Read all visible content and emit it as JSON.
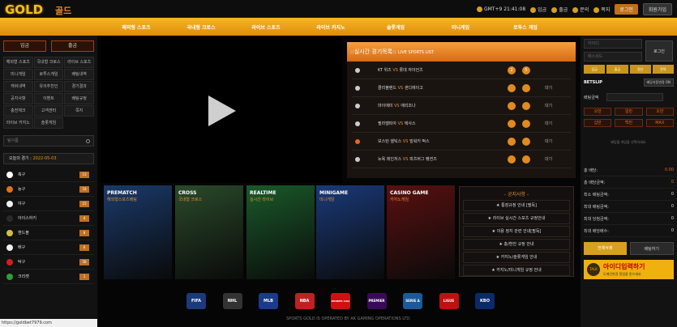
{
  "header": {
    "logo": "GOLD",
    "logo_ko": "골드",
    "clock": "GMT+9 21:41:08",
    "links": [
      "입금",
      "출금",
      "문의",
      "쪽지"
    ],
    "login": "로그인",
    "join": "회원가입"
  },
  "nav": [
    "해외형 스포츠",
    "국내형 크로스",
    "라이브 스포츠",
    "라이브 카지노",
    "슬롯게임",
    "미니게임",
    "로투스 게임"
  ],
  "left": {
    "deposit": "입금",
    "withdraw": "출금",
    "menu": [
      "해외형 스포츠",
      "국내형 크로스",
      "라이브 스포츠",
      "미니게임",
      "로투스게임",
      "배팅내역",
      "캐쉬내역",
      "유의추천인",
      "경기결과",
      "공지사항",
      "이벤트",
      "배팅규정",
      "충전체크",
      "고객센터",
      "쪽지",
      "라이브 카지노",
      "슬롯게임"
    ],
    "search_placeholder": "팀이름",
    "today": "오늘의 경기 :",
    "today_date": "2022-05-03",
    "sports": [
      {
        "name": "축구",
        "count": "13",
        "color": "#ffffff"
      },
      {
        "name": "농구",
        "count": "18",
        "color": "#e07020"
      },
      {
        "name": "야구",
        "count": "15",
        "color": "#f0f0f0"
      },
      {
        "name": "아이스하키",
        "count": "4",
        "color": "#2a2a2a"
      },
      {
        "name": "핸드볼",
        "count": "8",
        "color": "#d0c040"
      },
      {
        "name": "배구",
        "count": "6",
        "color": "#f0f0f0"
      },
      {
        "name": "탁구",
        "count": "58",
        "color": "#d02020"
      },
      {
        "name": "크리켓",
        "count": "1",
        "color": "#30a030"
      }
    ],
    "status_url": "https://goldbet7979.com"
  },
  "live": {
    "title": "::실시간 경기목록::",
    "title_en": "LIVE SPORTS LIST",
    "rows": [
      {
        "home": "KT 위즈",
        "vs": "VS",
        "away": "롯데 자이언츠",
        "status": ""
      },
      {
        "home": "클리블랜드",
        "vs": "VS",
        "away": "샌디에이고",
        "status": "대기"
      },
      {
        "home": "마이애미",
        "vs": "VS",
        "away": "애리조나",
        "status": "대기"
      },
      {
        "home": "필라델피아",
        "vs": "VS",
        "away": "텍사스",
        "status": "대기"
      },
      {
        "home": "보스턴 셀틱스",
        "vs": "VS",
        "away": "밀워키 벅스",
        "status": "대기"
      },
      {
        "home": "뉴욕 레인저스",
        "vs": "VS",
        "away": "피츠버그 펭귄즈",
        "status": "대기"
      }
    ],
    "score": [
      "2",
      "5"
    ]
  },
  "promos": [
    {
      "title": "PREMATCH",
      "sub": "해외형스포츠베팅",
      "bg": "#1a3a6a"
    },
    {
      "title": "CROSS",
      "sub": "국내형 크로스",
      "bg": "#2a4a2a"
    },
    {
      "title": "REALTIME",
      "sub": "실시간 라이브",
      "bg": "#1a5a2a"
    },
    {
      "title": "MINIGAME",
      "sub": "미니게임",
      "bg": "#1a3a7a"
    },
    {
      "title": "CASINO GAME",
      "sub": "카지노게임",
      "bg": "#5a1010"
    }
  ],
  "notice": {
    "title": "- 공지사항 -",
    "items": [
      "★ 통장규정 안내 [필독]",
      "★ 라이브 실시간 스포츠 규정안내",
      "★ 이용 정지 관련 안내[필독]",
      "★ 충/환전 규정 안내",
      "★ 카지노/슬롯게임 안내",
      "★ 카지노/미니게임 규정 안내"
    ]
  },
  "logos": [
    "FIFA",
    "NHL",
    "MLB",
    "NBA",
    "BUNDES LIGA",
    "PREMIER",
    "SERIE A",
    "LIGUE",
    "KBO"
  ],
  "footer": "SPORTS GOLD IS OPERATED BY AK GAMING OPERATIONS LTD.",
  "right": {
    "id_ph": "아이디",
    "pw_ph": "패스워드",
    "login": "로그인",
    "btns": [
      "입금",
      "출금",
      "정산",
      "문의"
    ],
    "betslip": "BETSLIP",
    "auto": "배당자동변경 ON",
    "bet_amount": "배팅금액",
    "amounts": [
      "오만",
      "일만",
      "오만",
      "십만",
      "백만",
      "MAX"
    ],
    "empty": "배팅할 게임을 선택하세요.",
    "stats": [
      {
        "label": "총 배당:",
        "value": "0.00",
        "orange": true
      },
      {
        "label": "총 배당금액:",
        "value": "0",
        "orange": true
      },
      {
        "label": "최소 배팅금액:",
        "value": "0"
      },
      {
        "label": "최대 배팅금액:",
        "value": "0"
      },
      {
        "label": "최대 당첨금액:",
        "value": "0"
      },
      {
        "label": "최대 배당배수:",
        "value": "0"
      }
    ],
    "reset": "전체삭제",
    "place": "배팅하기",
    "kakao_title": "아이디입력하기",
    "kakao_sub": "도메인변경 알림을 받으세요"
  }
}
